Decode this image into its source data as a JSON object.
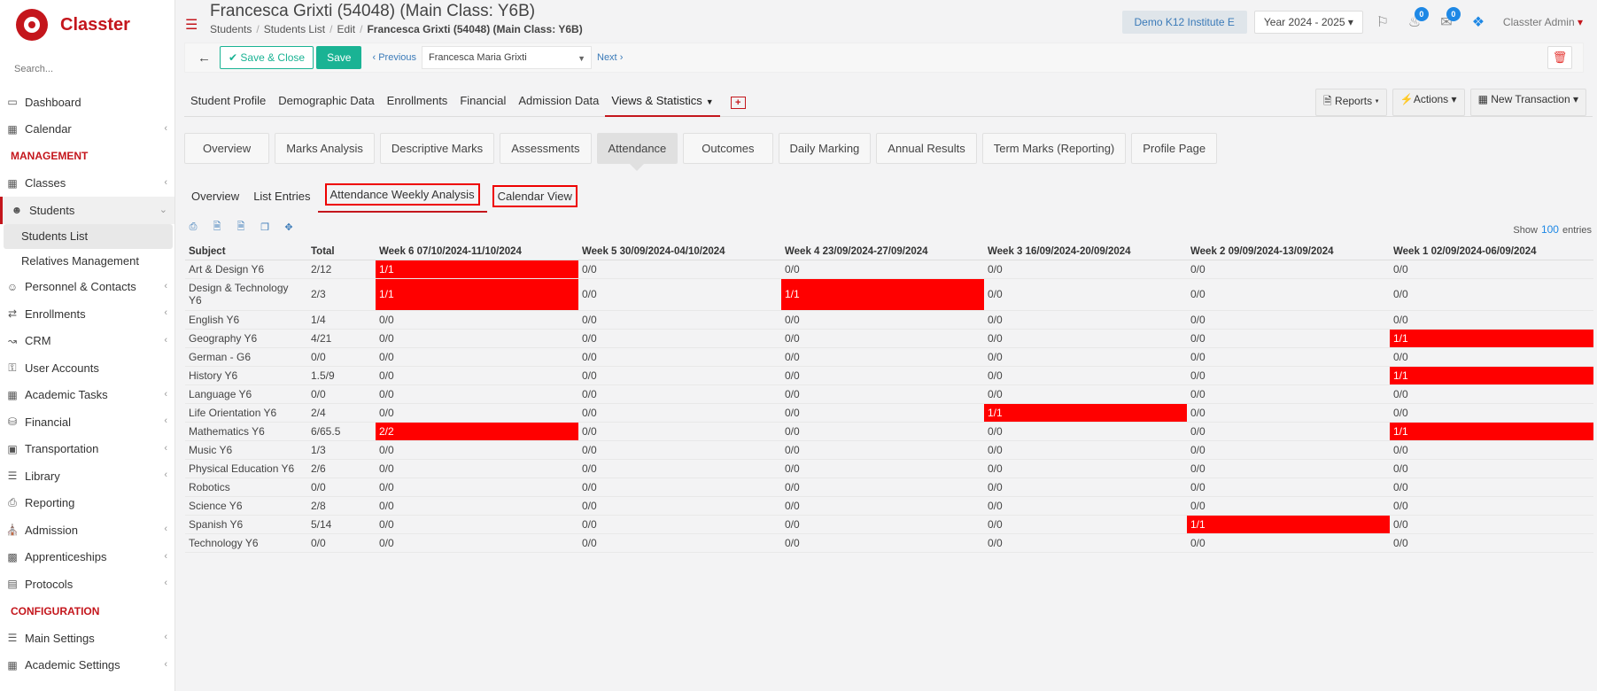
{
  "app": {
    "name": "Classter"
  },
  "sidebar": {
    "search_placeholder": "Search...",
    "items": [
      {
        "label": "Dashboard",
        "icon": "laptop-icon"
      },
      {
        "label": "Calendar",
        "icon": "calendar-icon",
        "chevron": "‹"
      },
      {
        "section": "MANAGEMENT"
      },
      {
        "label": "Classes",
        "icon": "grid-icon",
        "chevron": "‹"
      },
      {
        "label": "Students",
        "icon": "users-icon",
        "chevron": "⌄",
        "active": true
      },
      {
        "label": "Students List",
        "sub": true,
        "current": true
      },
      {
        "label": "Relatives Management",
        "sub": true
      },
      {
        "label": "Personnel & Contacts",
        "icon": "user-icon",
        "chevron": "‹"
      },
      {
        "label": "Enrollments",
        "icon": "exchange-icon",
        "chevron": "‹"
      },
      {
        "label": "CRM",
        "icon": "chart-line-icon",
        "chevron": "‹"
      },
      {
        "label": "User Accounts",
        "icon": "key-icon"
      },
      {
        "label": "Academic Tasks",
        "icon": "tasks-icon",
        "chevron": "‹"
      },
      {
        "label": "Financial",
        "icon": "coins-icon",
        "chevron": "‹"
      },
      {
        "label": "Transportation",
        "icon": "bus-icon",
        "chevron": "‹"
      },
      {
        "label": "Library",
        "icon": "books-icon",
        "chevron": "‹"
      },
      {
        "label": "Reporting",
        "icon": "printer-icon"
      },
      {
        "label": "Admission",
        "icon": "bank-icon",
        "chevron": "‹"
      },
      {
        "label": "Apprenticeships",
        "icon": "cube-icon",
        "chevron": "‹"
      },
      {
        "label": "Protocols",
        "icon": "file-icon",
        "chevron": "‹"
      },
      {
        "section": "CONFIGURATION"
      },
      {
        "label": "Main Settings",
        "icon": "sliders-icon",
        "chevron": "‹"
      },
      {
        "label": "Academic Settings",
        "icon": "grid-icon",
        "chevron": "‹"
      }
    ]
  },
  "header": {
    "title": "Francesca Grixti (54048) (Main Class: Y6B)",
    "breadcrumb": [
      "Students",
      "Students List",
      "Edit",
      "Francesca Grixti (54048) (Main Class: Y6B)"
    ],
    "institute": "Demo K12 Institute E",
    "year": "Year 2024 - 2025",
    "notifications": "0",
    "messages": "0",
    "user": "Classter Admin"
  },
  "toolbar": {
    "save_close": "Save & Close",
    "save": "Save",
    "previous": "Previous",
    "student": "Francesca Maria Grixti",
    "next": "Next"
  },
  "main_tabs": [
    "Student Profile",
    "Demographic Data",
    "Enrollments",
    "Financial",
    "Admission Data",
    "Views & Statistics"
  ],
  "right_buttons": [
    "Reports",
    "Actions",
    "New Transaction"
  ],
  "sub_tabs": [
    "Overview",
    "Marks Analysis",
    "Descriptive Marks",
    "Assessments",
    "Attendance",
    "Outcomes",
    "Daily Marking",
    "Annual Results",
    "Term Marks (Reporting)",
    "Profile Page"
  ],
  "attendance_tabs": [
    "Overview",
    "List Entries",
    "Attendance Weekly Analysis",
    "Calendar View"
  ],
  "table": {
    "show_label": "Show",
    "show_count": "100",
    "entries_label": "entries",
    "headers": [
      "Subject",
      "Total",
      "Week 6 07/10/2024-11/10/2024",
      "Week 5 30/09/2024-04/10/2024",
      "Week 4 23/09/2024-27/09/2024",
      "Week 3 16/09/2024-20/09/2024",
      "Week 2 09/09/2024-13/09/2024",
      "Week 1 02/09/2024-06/09/2024"
    ],
    "rows": [
      {
        "subject": "Art & Design Y6",
        "total": "2/12",
        "weeks": [
          "1/1",
          "0/0",
          "0/0",
          "0/0",
          "0/0",
          "0/0"
        ],
        "red": [
          0
        ]
      },
      {
        "subject": "Design & Technology Y6",
        "total": "2/3",
        "weeks": [
          "1/1",
          "0/0",
          "1/1",
          "0/0",
          "0/0",
          "0/0"
        ],
        "red": [
          0,
          2
        ],
        "tall": true
      },
      {
        "subject": "English Y6",
        "total": "1/4",
        "weeks": [
          "0/0",
          "0/0",
          "0/0",
          "0/0",
          "0/0",
          "0/0"
        ],
        "red": []
      },
      {
        "subject": "Geography Y6",
        "total": "4/21",
        "weeks": [
          "0/0",
          "0/0",
          "0/0",
          "0/0",
          "0/0",
          "1/1"
        ],
        "red": [
          5
        ]
      },
      {
        "subject": "German - G6",
        "total": "0/0",
        "weeks": [
          "0/0",
          "0/0",
          "0/0",
          "0/0",
          "0/0",
          "0/0"
        ],
        "red": []
      },
      {
        "subject": "History Y6",
        "total": "1.5/9",
        "weeks": [
          "0/0",
          "0/0",
          "0/0",
          "0/0",
          "0/0",
          "1/1"
        ],
        "red": [
          5
        ]
      },
      {
        "subject": "Language Y6",
        "total": "0/0",
        "weeks": [
          "0/0",
          "0/0",
          "0/0",
          "0/0",
          "0/0",
          "0/0"
        ],
        "red": []
      },
      {
        "subject": "Life Orientation Y6",
        "total": "2/4",
        "weeks": [
          "0/0",
          "0/0",
          "0/0",
          "1/1",
          "0/0",
          "0/0"
        ],
        "red": [
          3
        ]
      },
      {
        "subject": "Mathematics Y6",
        "total": "6/65.5",
        "weeks": [
          "2/2",
          "0/0",
          "0/0",
          "0/0",
          "0/0",
          "1/1"
        ],
        "red": [
          0,
          5
        ]
      },
      {
        "subject": "Music Y6",
        "total": "1/3",
        "weeks": [
          "0/0",
          "0/0",
          "0/0",
          "0/0",
          "0/0",
          "0/0"
        ],
        "red": []
      },
      {
        "subject": "Physical Education Y6",
        "total": "2/6",
        "weeks": [
          "0/0",
          "0/0",
          "0/0",
          "0/0",
          "0/0",
          "0/0"
        ],
        "red": []
      },
      {
        "subject": "Robotics",
        "total": "0/0",
        "weeks": [
          "0/0",
          "0/0",
          "0/0",
          "0/0",
          "0/0",
          "0/0"
        ],
        "red": []
      },
      {
        "subject": "Science Y6",
        "total": "2/8",
        "weeks": [
          "0/0",
          "0/0",
          "0/0",
          "0/0",
          "0/0",
          "0/0"
        ],
        "red": []
      },
      {
        "subject": "Spanish Y6",
        "total": "5/14",
        "weeks": [
          "0/0",
          "0/0",
          "0/0",
          "0/0",
          "1/1",
          "0/0"
        ],
        "red": [
          4
        ]
      },
      {
        "subject": "Technology Y6",
        "total": "0/0",
        "weeks": [
          "0/0",
          "0/0",
          "0/0",
          "0/0",
          "0/0",
          "0/0"
        ],
        "red": []
      }
    ]
  },
  "colors": {
    "brand": "#c4161c",
    "accent": "#1ab394",
    "highlight": "#ff0000",
    "link": "#3a7ab8"
  }
}
